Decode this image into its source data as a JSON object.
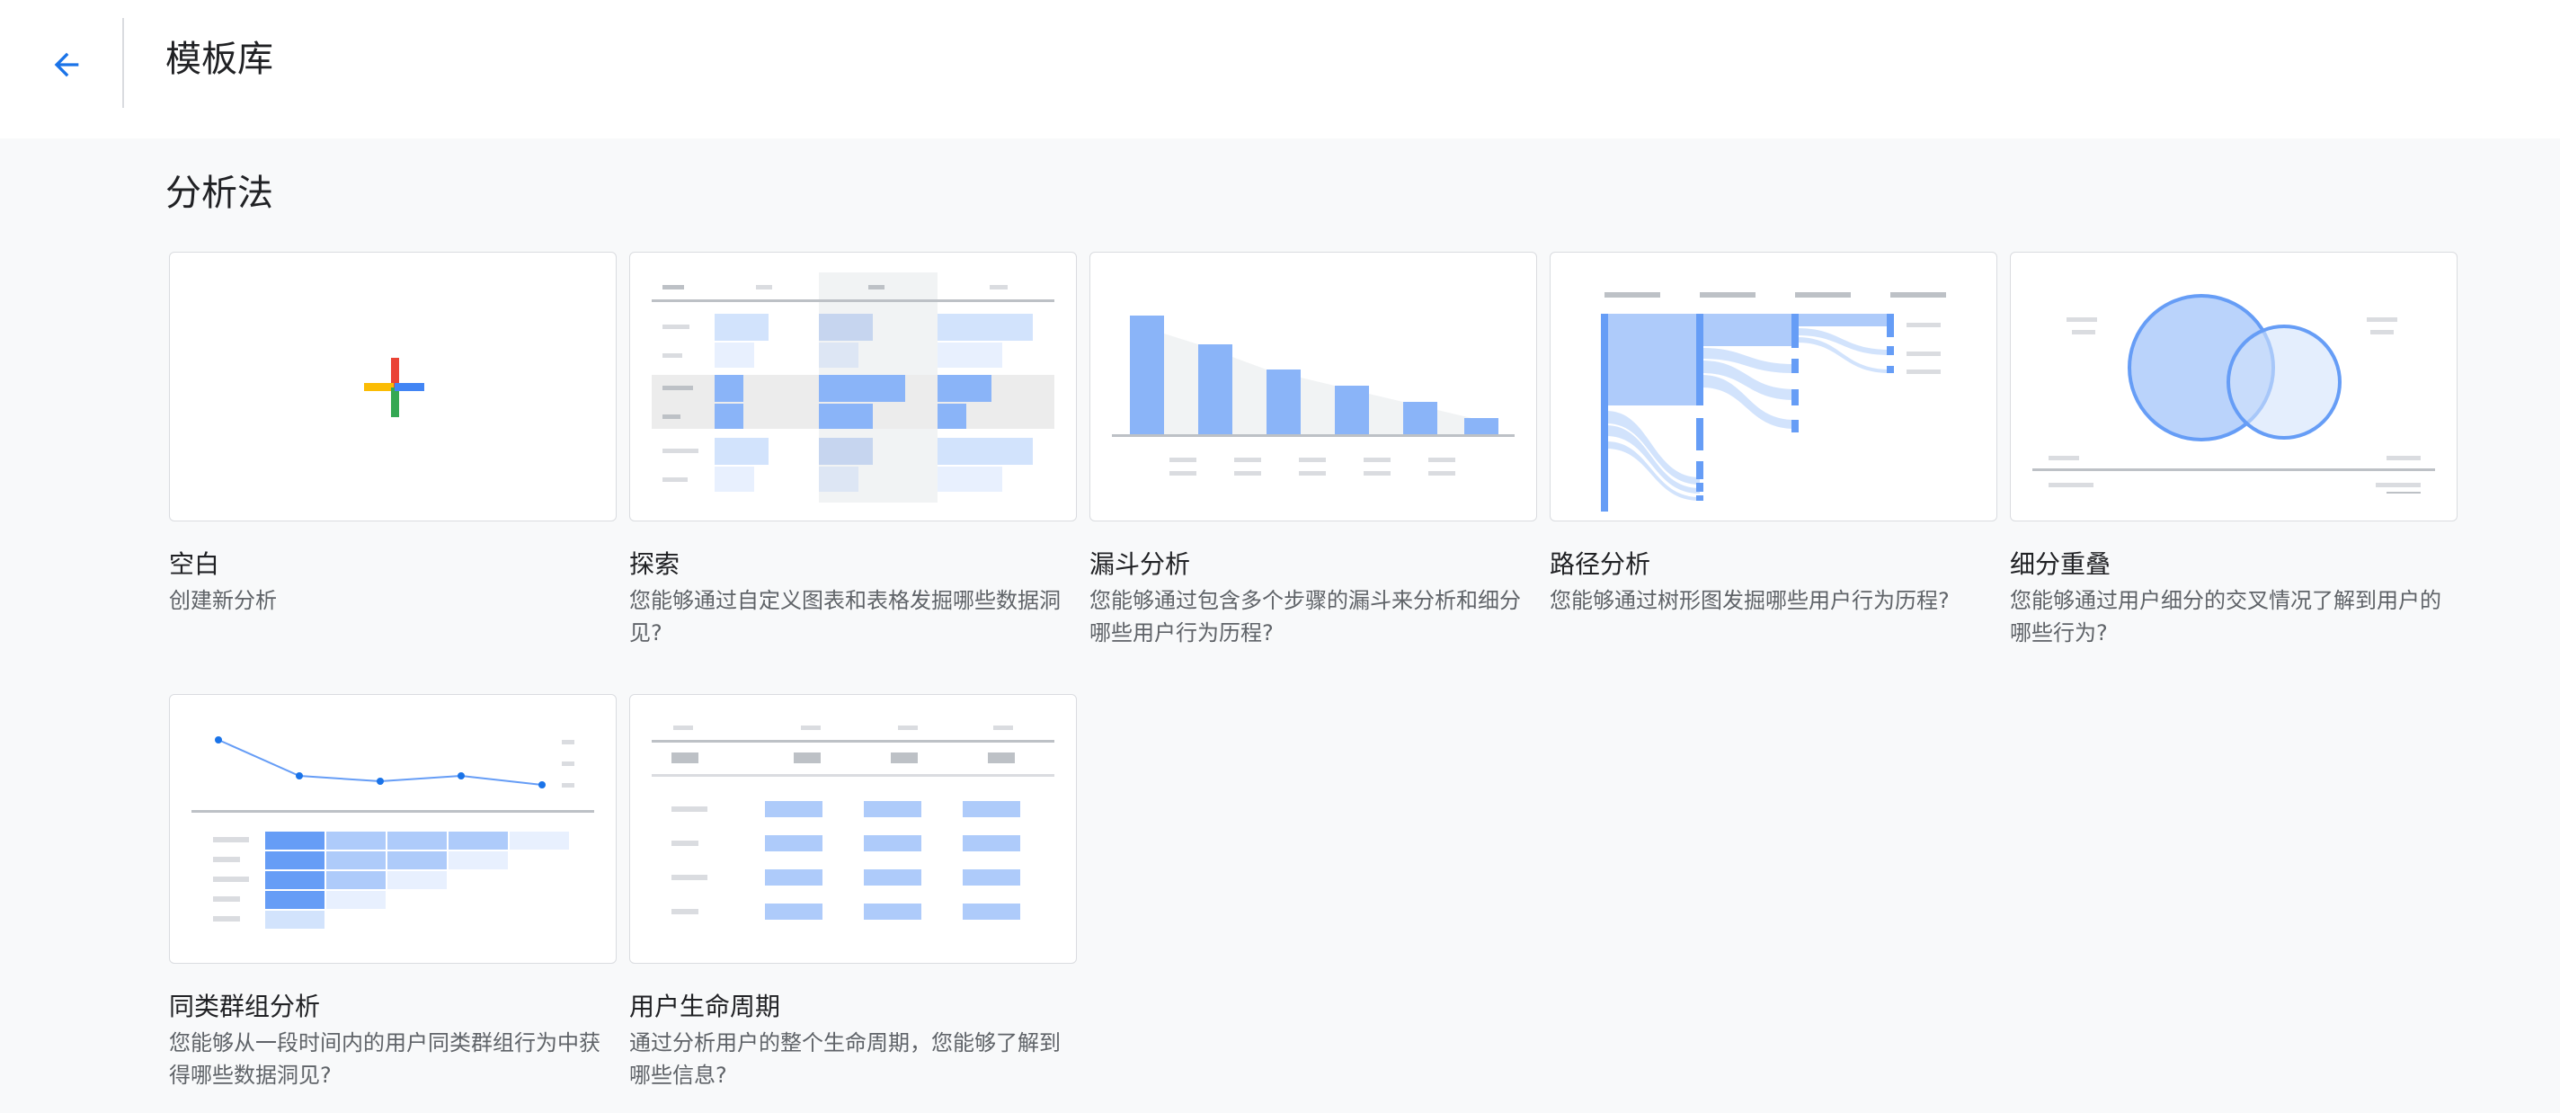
{
  "header": {
    "title": "模板库",
    "back_icon": "arrow-back-icon"
  },
  "section": {
    "title": "分析法"
  },
  "colors": {
    "accent": "#1a73e8",
    "bar": "#8ab4f8",
    "bar_light": "#d2e3fc",
    "text_secondary": "#5f6368"
  },
  "templates": [
    {
      "title": "空白",
      "description": "创建新分析",
      "icon": "plus-icon"
    },
    {
      "title": "探索",
      "description": "您能够通过自定义图表和表格发掘哪些数据洞见?",
      "icon": "table-thumbnail"
    },
    {
      "title": "漏斗分析",
      "description": "您能够通过包含多个步骤的漏斗来分析和细分哪些用户行为历程?",
      "icon": "funnel-thumbnail"
    },
    {
      "title": "路径分析",
      "description": "您能够通过树形图发掘哪些用户行为历程?",
      "icon": "path-thumbnail"
    },
    {
      "title": "细分重叠",
      "description": "您能够通过用户细分的交叉情况了解到用户的哪些行为?",
      "icon": "venn-thumbnail"
    },
    {
      "title": "同类群组分析",
      "description": "您能够从一段时间内的用户同类群组行为中获得哪些数据洞见?",
      "icon": "cohort-thumbnail"
    },
    {
      "title": "用户生命周期",
      "description": "通过分析用户的整个生命周期，您能够了解到哪些信息?",
      "icon": "lifetime-thumbnail"
    }
  ]
}
